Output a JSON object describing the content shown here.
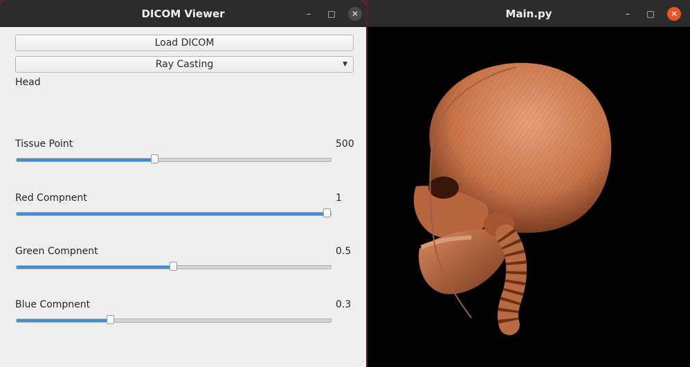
{
  "left_window": {
    "title": "DICOM Viewer",
    "load_button": "Load DICOM",
    "render_mode": "Ray Casting",
    "dataset_label": "Head",
    "sliders": [
      {
        "label": "Tissue Point",
        "value": "500",
        "fraction": 0.44
      },
      {
        "label": "Red Compnent",
        "value": "1",
        "fraction": 1.0
      },
      {
        "label": "Green Compnent",
        "value": "0.5",
        "fraction": 0.5
      },
      {
        "label": "Blue Compnent",
        "value": "0.3",
        "fraction": 0.3
      }
    ]
  },
  "right_window": {
    "title": "Main.py",
    "content": "skull volume rendering"
  },
  "icons": {
    "minimize": "minimize-icon",
    "maximize": "maximize-icon",
    "close": "close-icon",
    "dropdown": "chevron-down-icon"
  },
  "colors": {
    "close_inactive": "#4a4a4a",
    "close_active": "#e95420",
    "slider_fill": "#3b8fd6",
    "skull": "#c8744a"
  }
}
